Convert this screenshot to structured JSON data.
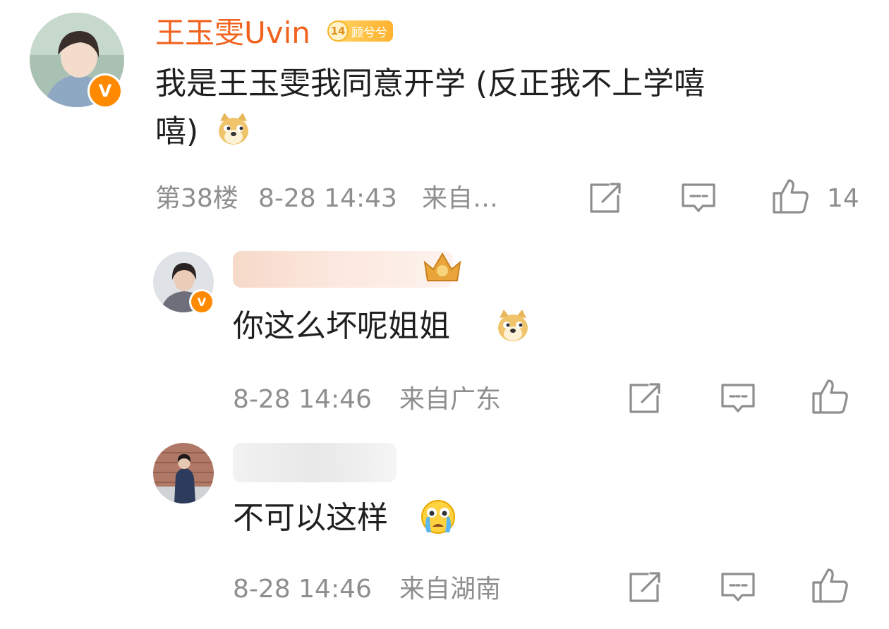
{
  "comments": [
    {
      "username": "王玉雯Uvin",
      "fan_badge": {
        "level": "14",
        "name": "顾兮兮"
      },
      "text_line1": "我是王玉雯我同意开学 (反正我不上学嘻",
      "text_line2": "嘻)",
      "floor": "第38楼",
      "time": "8-28 14:43",
      "source": "来自…",
      "like_count": "14",
      "verified": "V"
    },
    {
      "username": "",
      "text": "你这么坏呢姐姐",
      "time": "8-28 14:46",
      "source": "来自广东",
      "verified": "V"
    },
    {
      "username": "",
      "text": "不可以这样",
      "time": "8-28 14:46",
      "source": "来自湖南"
    }
  ],
  "icons": {
    "repost": "repost-icon",
    "comment": "comment-icon",
    "like": "thumbs-up-icon",
    "doge": "doge-emoji",
    "crying": "crying-emoji",
    "crown": "crown-icon"
  },
  "colors": {
    "username": "#f0621e",
    "meta": "#8e8e8e",
    "verified": "#ff8a00",
    "badge": "#ffb22e"
  }
}
